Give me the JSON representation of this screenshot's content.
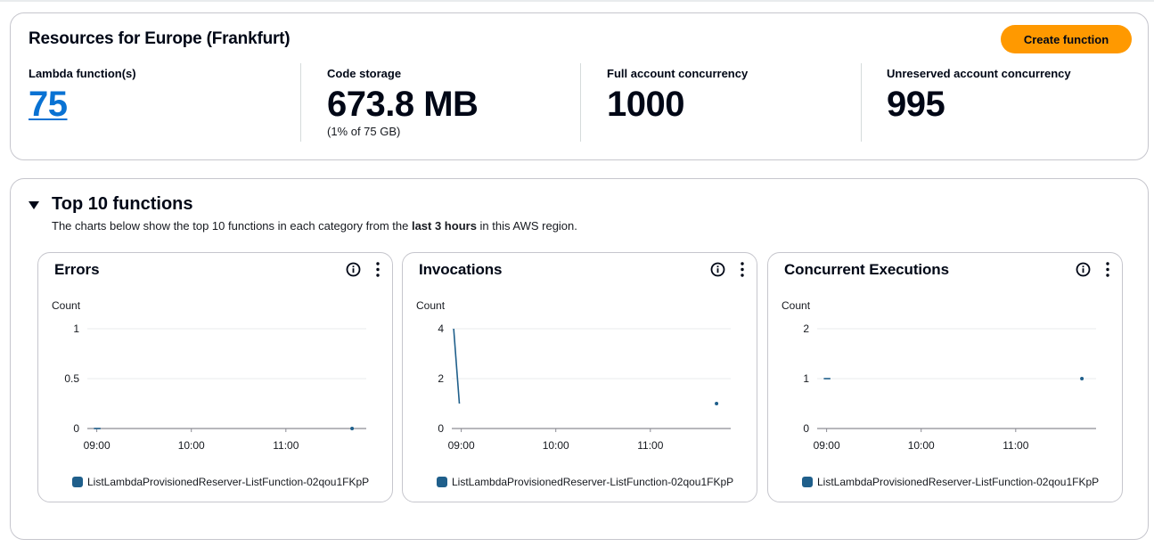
{
  "resources": {
    "title": "Resources for Europe (Frankfurt)",
    "create_button": "Create function",
    "stats": [
      {
        "label": "Lambda function(s)",
        "value": "75"
      },
      {
        "label": "Code storage",
        "value": "673.8 MB",
        "sub": "(1% of 75 GB)"
      },
      {
        "label": "Full account concurrency",
        "value": "1000"
      },
      {
        "label": "Unreserved account concurrency",
        "value": "995"
      }
    ]
  },
  "top10": {
    "title": "Top 10 functions",
    "desc_prefix": "The charts below show the top 10 functions in each category from the ",
    "desc_bold": "last 3 hours",
    "desc_suffix": " in this AWS region."
  },
  "icons": {
    "info": "info-icon",
    "more": "more-vertical-icon",
    "caret": "caret-down-icon"
  },
  "colors": {
    "accent_button": "#ff9900",
    "link": "#0972d3",
    "series": "#1f5f8b"
  },
  "chart_data": [
    {
      "type": "line",
      "title": "Errors",
      "ylabel": "Count",
      "yticks": [
        "1",
        "0.5",
        "0"
      ],
      "ylim": [
        0,
        1
      ],
      "xtick_labels": [
        "09:00",
        "10:00",
        "11:00"
      ],
      "xticks_hours": [
        9,
        10,
        11
      ],
      "xlim_hours": [
        8.9,
        11.85
      ],
      "series": [
        {
          "name": "ListLambdaProvisionedReserver-ListFunction-02qou1FKpP",
          "segments": [
            [
              [
                8.97,
                0
              ],
              [
                9.04,
                0
              ]
            ]
          ],
          "points": [
            [
              11.7,
              0
            ]
          ]
        }
      ]
    },
    {
      "type": "line",
      "title": "Invocations",
      "ylabel": "Count",
      "yticks": [
        "4",
        "2",
        "0"
      ],
      "ylim": [
        0,
        4
      ],
      "xtick_labels": [
        "09:00",
        "10:00",
        "11:00"
      ],
      "xticks_hours": [
        9,
        10,
        11
      ],
      "xlim_hours": [
        8.9,
        11.85
      ],
      "series": [
        {
          "name": "ListLambdaProvisionedReserver-ListFunction-02qou1FKpP",
          "segments": [
            [
              [
                8.92,
                4
              ],
              [
                8.98,
                1
              ]
            ]
          ],
          "points": [
            [
              11.7,
              1
            ]
          ]
        }
      ]
    },
    {
      "type": "line",
      "title": "Concurrent Executions",
      "ylabel": "Count",
      "yticks": [
        "2",
        "1",
        "0"
      ],
      "ylim": [
        0,
        2
      ],
      "xtick_labels": [
        "09:00",
        "10:00",
        "11:00"
      ],
      "xticks_hours": [
        9,
        10,
        11
      ],
      "xlim_hours": [
        8.9,
        11.85
      ],
      "series": [
        {
          "name": "ListLambdaProvisionedReserver-ListFunction-02qou1FKpP",
          "segments": [
            [
              [
                8.97,
                1
              ],
              [
                9.04,
                1
              ]
            ]
          ],
          "points": [
            [
              11.7,
              1
            ]
          ]
        }
      ]
    }
  ]
}
